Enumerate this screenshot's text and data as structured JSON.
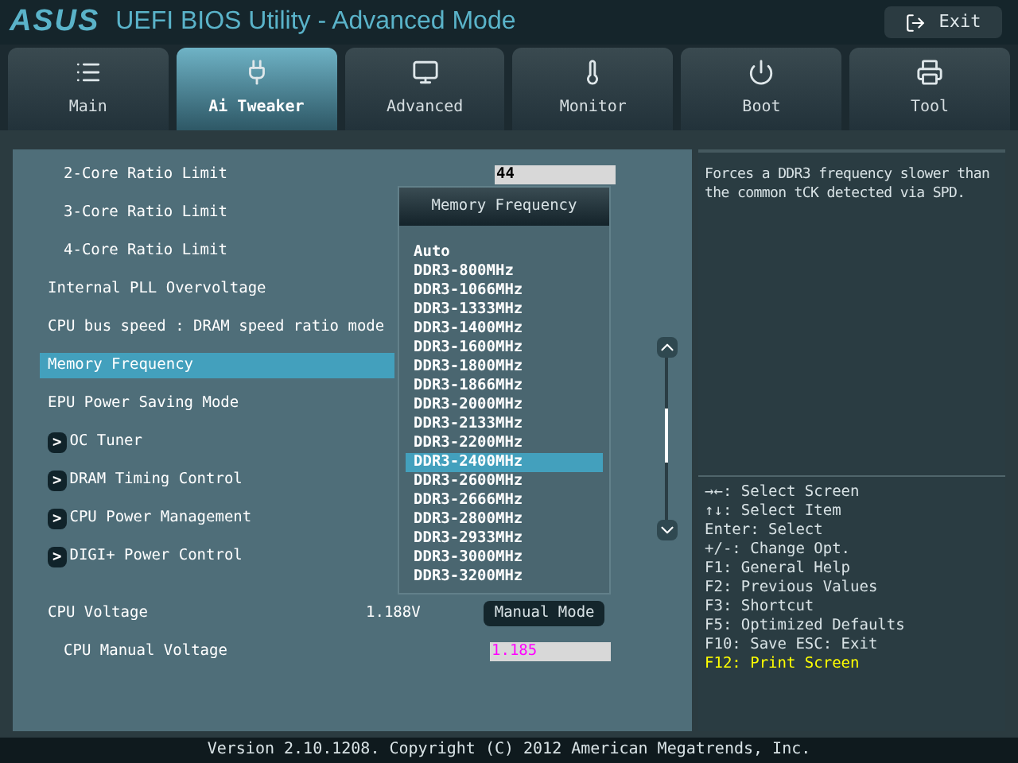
{
  "header": {
    "logo": "ASUS",
    "title": "UEFI BIOS Utility - Advanced Mode",
    "exit": "Exit"
  },
  "tabs": [
    {
      "label": "Main",
      "selected": false
    },
    {
      "label": "Ai Tweaker",
      "selected": true
    },
    {
      "label": "Advanced",
      "selected": false
    },
    {
      "label": "Monitor",
      "selected": false
    },
    {
      "label": "Boot",
      "selected": false
    },
    {
      "label": "Tool",
      "selected": false
    }
  ],
  "settings": [
    {
      "kind": "sub",
      "label": "2-Core Ratio Limit",
      "selected": false,
      "value": "44"
    },
    {
      "kind": "sub",
      "label": "3-Core Ratio Limit",
      "selected": false
    },
    {
      "kind": "sub",
      "label": "4-Core Ratio Limit",
      "selected": false
    },
    {
      "kind": "setting",
      "label": "Internal PLL Overvoltage",
      "selected": false
    },
    {
      "kind": "setting",
      "label": "CPU bus speed : DRAM speed ratio mode",
      "selected": false
    },
    {
      "kind": "setting",
      "label": "Memory Frequency",
      "selected": true
    },
    {
      "kind": "setting",
      "label": "EPU Power Saving Mode",
      "selected": false
    },
    {
      "kind": "submenu",
      "label": "OC Tuner",
      "arrow": ">",
      "selected": false
    },
    {
      "kind": "submenu",
      "label": "DRAM Timing Control",
      "arrow": ">",
      "selected": false
    },
    {
      "kind": "submenu",
      "label": "CPU Power Management",
      "arrow": ">",
      "selected": false
    },
    {
      "kind": "submenu",
      "label": "DIGI+ Power Control",
      "arrow": ">",
      "selected": false
    }
  ],
  "voltage_rows": [
    {
      "label": "CPU Voltage",
      "reading": "1.188V",
      "mode": "Manual Mode"
    },
    {
      "label": "CPU Manual Voltage",
      "value": "1.185"
    }
  ],
  "popup": {
    "title": "Memory Frequency",
    "options": [
      {
        "label": "Auto",
        "selected": false
      },
      {
        "label": "DDR3-800MHz",
        "selected": false
      },
      {
        "label": "DDR3-1066MHz",
        "selected": false
      },
      {
        "label": "DDR3-1333MHz",
        "selected": false
      },
      {
        "label": "DDR3-1400MHz",
        "selected": false
      },
      {
        "label": "DDR3-1600MHz",
        "selected": false
      },
      {
        "label": "DDR3-1800MHz",
        "selected": false
      },
      {
        "label": "DDR3-1866MHz",
        "selected": false
      },
      {
        "label": "DDR3-2000MHz",
        "selected": false
      },
      {
        "label": "DDR3-2133MHz",
        "selected": false
      },
      {
        "label": "DDR3-2200MHz",
        "selected": false
      },
      {
        "label": "DDR3-2400MHz",
        "selected": true
      },
      {
        "label": "DDR3-2600MHz",
        "selected": false
      },
      {
        "label": "DDR3-2666MHz",
        "selected": false
      },
      {
        "label": "DDR3-2800MHz",
        "selected": false
      },
      {
        "label": "DDR3-2933MHz",
        "selected": false
      },
      {
        "label": "DDR3-3000MHz",
        "selected": false
      },
      {
        "label": "DDR3-3200MHz",
        "selected": false
      }
    ]
  },
  "help": {
    "description": "Forces a DDR3 frequency slower than the common tCK detected via SPD.",
    "keys": [
      {
        "text": "→←: Select Screen",
        "highlighted": false
      },
      {
        "text": "↑↓: Select Item",
        "highlighted": false
      },
      {
        "text": "Enter: Select",
        "highlighted": false
      },
      {
        "text": "+/-: Change Opt.",
        "highlighted": false
      },
      {
        "text": "F1: General Help",
        "highlighted": false
      },
      {
        "text": "F2: Previous Values",
        "highlighted": false
      },
      {
        "text": "F3: Shortcut",
        "highlighted": false
      },
      {
        "text": "F5: Optimized Defaults",
        "highlighted": false
      },
      {
        "text": "F10: Save  ESC: Exit",
        "highlighted": false
      },
      {
        "text": "F12: Print Screen",
        "highlighted": true
      }
    ]
  },
  "footer": "Version 2.10.1208. Copyright (C) 2012 American Megatrends, Inc."
}
